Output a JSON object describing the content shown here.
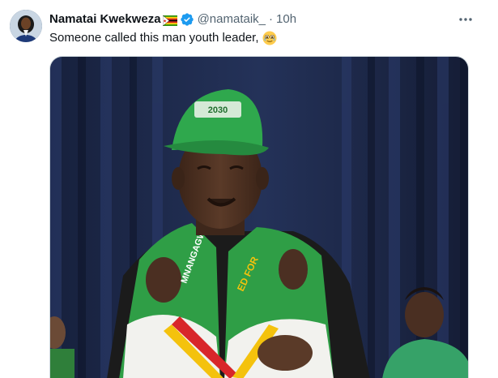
{
  "tweet": {
    "author": {
      "display_name": "Namatai Kwekweza",
      "flag_icon": "zimbabwe-flag-icon",
      "verified_icon": "verified-badge-icon",
      "handle": "@namataik_",
      "separator": "·",
      "time": "10h"
    },
    "text": "Someone called this man youth leader,",
    "emoji": "smiling-face-with-tear-eyes-emoji",
    "more_icon": "more-horizontal-icon",
    "media": {
      "description_icon": "photo-elderly-man-green-cap-vest",
      "cap_text": "2030",
      "vest_text_left": "MNANGAGWA",
      "vest_text_right": "ED FOR"
    }
  },
  "colors": {
    "text_primary": "#0f1419",
    "text_secondary": "#536471",
    "verified_blue": "#1d9bf0",
    "border": "#cfd9de"
  }
}
